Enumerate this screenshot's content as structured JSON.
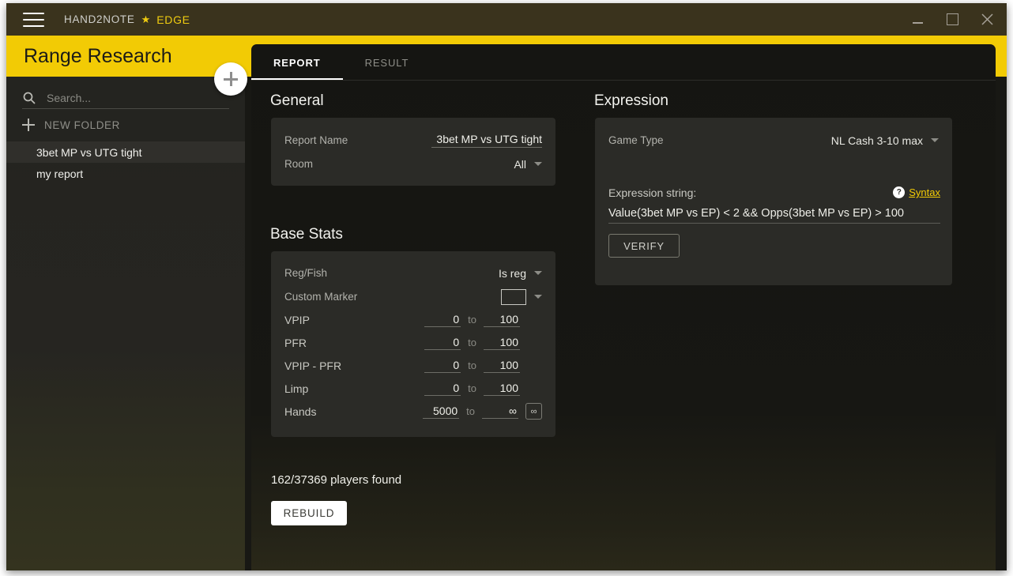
{
  "titlebar": {
    "menu_icon": "hamburger-menu-icon",
    "brand_name": "HAND2NOTE",
    "brand_star": "★",
    "brand_edition": "EDGE",
    "minimize_label": "Minimize",
    "maximize_label": "Maximize",
    "close_label": "Close"
  },
  "header": {
    "title": "Range Research",
    "accent_color": "#f2cb05"
  },
  "sidebar": {
    "search": {
      "icon": "search-icon",
      "value": "",
      "placeholder": "Search..."
    },
    "new_folder_label": "NEW FOLDER",
    "add_button_label": "+",
    "reports": [
      {
        "label": "3bet MP vs UTG tight",
        "selected": true
      },
      {
        "label": "my report",
        "selected": false
      }
    ]
  },
  "tabs": [
    {
      "label": "REPORT",
      "active": true
    },
    {
      "label": "RESULT",
      "active": false
    }
  ],
  "general": {
    "section_title": "General",
    "report_name_label": "Report Name",
    "report_name_value": "3bet MP vs UTG tight",
    "room_label": "Room",
    "room_value": "All"
  },
  "base_stats": {
    "section_title": "Base Stats",
    "reg_fish_label": "Reg/Fish",
    "reg_fish_value": "Is reg",
    "custom_marker_label": "Custom Marker",
    "custom_marker_value": "",
    "to_label": "to",
    "rows": [
      {
        "label": "VPIP",
        "min": "0",
        "max": "100"
      },
      {
        "label": "PFR",
        "min": "0",
        "max": "100"
      },
      {
        "label": "VPIP - PFR",
        "min": "0",
        "max": "100"
      },
      {
        "label": "Limp",
        "min": "0",
        "max": "100"
      },
      {
        "label": "Hands",
        "min": "5000",
        "max": "∞"
      }
    ],
    "infinity_button_label": "∞"
  },
  "expression": {
    "section_title": "Expression",
    "game_type_label": "Game Type",
    "game_type_value": "NL Cash 3-10 max",
    "expression_string_label": "Expression string:",
    "help_badge": "?",
    "syntax_link_label": "Syntax",
    "expression_value": "Value(3bet MP vs EP) < 2 && Opps(3bet MP vs EP) > 100",
    "verify_label": "VERIFY"
  },
  "footer": {
    "players_found": "162/37369 players found",
    "rebuild_label": "REBUILD"
  }
}
